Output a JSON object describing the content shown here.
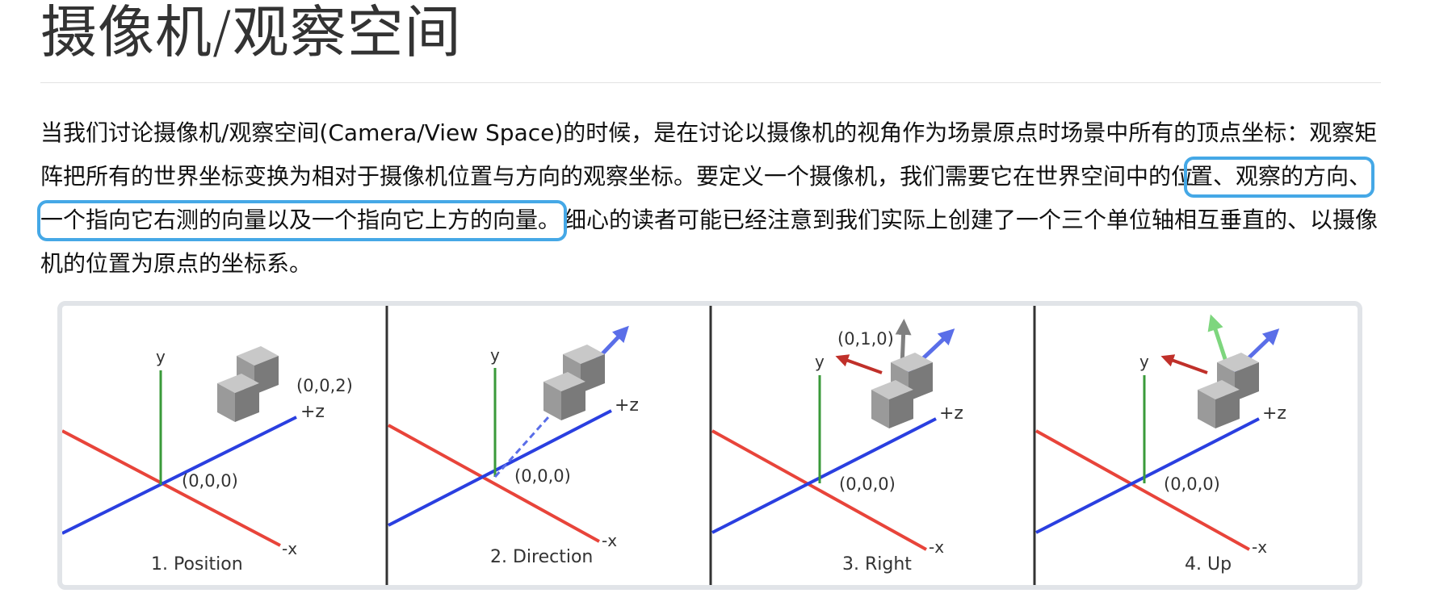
{
  "title": "摄像机/观察空间",
  "paragraph": {
    "before": "当我们讨论摄像机/观察空间(Camera/View Space)的时候，是在讨论以摄像机的视角作为场景原点时场景中所有的顶点坐标：观察矩阵把所有的世界坐标变换为相对于摄像机位置与方向的观察坐标。要定义一个摄像机，我们需要它在世界空间中的位",
    "highlighted": "置、观察的方向、一个指向它右测的向量以及一个指向它上方的向量。",
    "after": "细心的读者可能已经注意到我们实际上创建了一个三个单位轴相互垂直的、以摄像机的位置为原点的坐标系。"
  },
  "figure": {
    "panels": [
      {
        "caption": "1. Position",
        "origin_label": "(0,0,0)",
        "y_label": "y",
        "z_label": "+z",
        "x_label": "-x",
        "camera_label": "(0,0,2)"
      },
      {
        "caption": "2. Direction",
        "origin_label": "(0,0,0)",
        "y_label": "y",
        "z_label": "+z",
        "x_label": "-x"
      },
      {
        "caption": "3. Right",
        "origin_label": "(0,0,0)",
        "y_label": "y",
        "z_label": "+z",
        "x_label": "-x",
        "up_label": "(0,1,0)"
      },
      {
        "caption": "4. Up",
        "origin_label": "(0,0,0)",
        "y_label": "y",
        "z_label": "+z",
        "x_label": "-x"
      }
    ],
    "colors": {
      "x_axis": "#e8443a",
      "y_axis": "#3a9a3a",
      "z_axis": "#2a3fe0",
      "direction_vector": "#5a6ee8",
      "right_vector": "#c0302a",
      "world_up": "#808080",
      "camera_up": "#7ed67e",
      "highlight": "#45a8e6"
    }
  }
}
